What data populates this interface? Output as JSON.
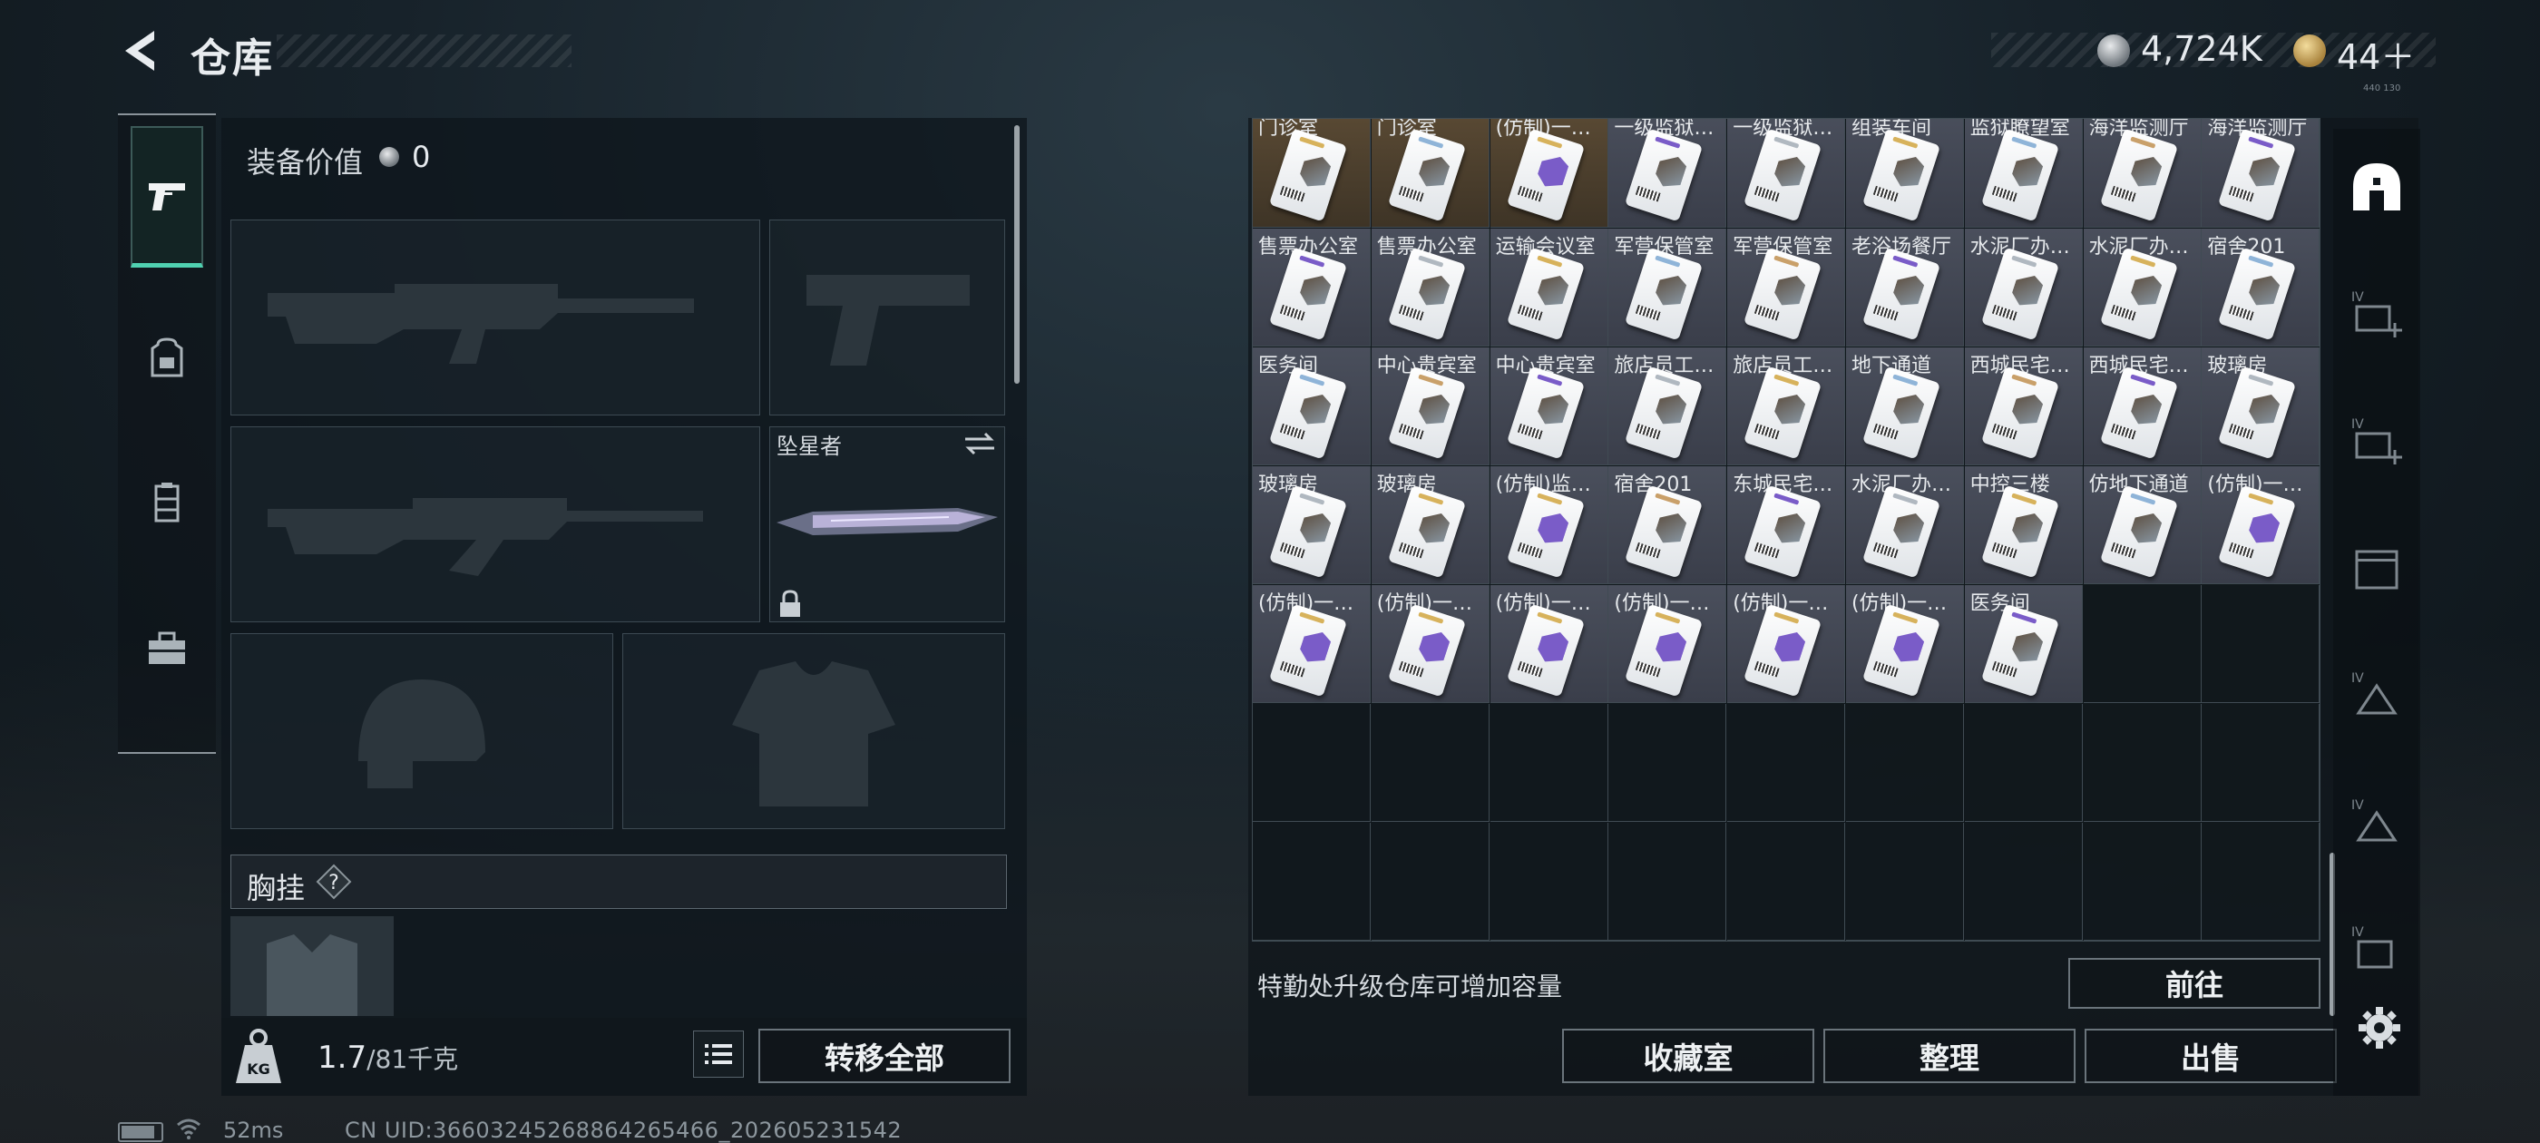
{
  "header": {
    "title": "仓库"
  },
  "currency": {
    "silver": "4,724K",
    "gold": "44＋",
    "tiny": "440 130"
  },
  "equipment": {
    "value_label": "装备价值",
    "value": "0",
    "knife_name": "坠星者",
    "chest_label": "胸挂",
    "chest_help": "?"
  },
  "weight": {
    "current": "1.7",
    "max": "/81千克"
  },
  "buttons": {
    "transfer_all": "转移全部",
    "goto": "前往",
    "collection": "收藏室",
    "sort": "整理",
    "sell": "出售"
  },
  "storage": {
    "upgrade_hint": "特勤处升级仓库可增加容量",
    "rows": [
      [
        "门诊室",
        "门诊室",
        "(仿制)一…",
        "一级监狱…",
        "一级监狱…",
        "组装车间",
        "监狱瞭望室",
        "海洋监测厅",
        "海洋监测厅"
      ],
      [
        "售票办公室",
        "售票办公室",
        "运输会议室",
        "军营保管室",
        "军营保管室",
        "老浴场餐厅",
        "水泥厂办…",
        "水泥厂办…",
        "宿舍201"
      ],
      [
        "医务间",
        "中心贵宾室",
        "中心贵宾室",
        "旅店员工…",
        "旅店员工…",
        "地下通道",
        "西城民宅…",
        "西城民宅…",
        "玻璃房"
      ],
      [
        "玻璃房",
        "玻璃房",
        "(仿制)监…",
        "宿舍201",
        "东城民宅…",
        "水泥厂办…",
        "中控三楼",
        "仿地下通道",
        "(仿制)一…"
      ],
      [
        "(仿制)一…",
        "(仿制)一…",
        "(仿制)一…",
        "(仿制)一…",
        "(仿制)一…",
        "(仿制)一…",
        "医务间"
      ]
    ]
  },
  "status": {
    "ping": "52ms",
    "uid": "CN UID:3660324526886426546​6_202605231542"
  },
  "colors": {
    "accent": "#4fd1b0",
    "gold": "#d7b25c",
    "purple": "#7a5cc8",
    "blue": "#8fb4d8"
  }
}
